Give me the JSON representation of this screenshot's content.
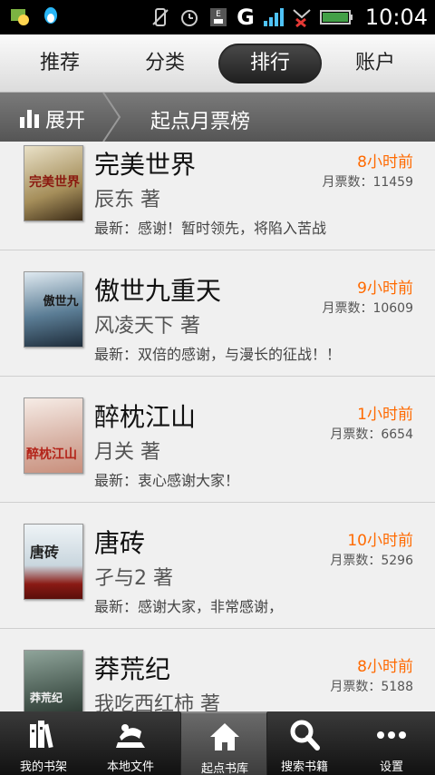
{
  "status_bar": {
    "time": "10:04",
    "network": "G",
    "icons": [
      "photo-icon",
      "qq-icon",
      "silent-icon",
      "alarm-icon",
      "usb-icon",
      "signal-icon",
      "no-signal-icon",
      "battery-icon"
    ]
  },
  "tabs": [
    {
      "label": "推荐",
      "active": false
    },
    {
      "label": "分类",
      "active": false
    },
    {
      "label": "排行",
      "active": true
    },
    {
      "label": "账户",
      "active": false
    }
  ],
  "title_bar": {
    "expand_label": "展开",
    "title": "起点月票榜"
  },
  "books": [
    {
      "title": "完美世界",
      "author": "辰东 著",
      "latest": "最新：感谢！暂时领先，将陷入苦战",
      "time": "8小时前",
      "votes": "月票数：11459"
    },
    {
      "title": "傲世九重天",
      "author": "风凌天下 著",
      "latest": "最新：双倍的感谢，与漫长的征战！！",
      "time": "9小时前",
      "votes": "月票数：10609"
    },
    {
      "title": "醉枕江山",
      "author": "月关 著",
      "latest": "最新：衷心感谢大家！",
      "time": "1小时前",
      "votes": "月票数：6654"
    },
    {
      "title": "唐砖",
      "author": "孑与2 著",
      "latest": "最新：感谢大家，非常感谢，",
      "time": "10小时前",
      "votes": "月票数：5296"
    },
    {
      "title": "莽荒纪",
      "author": "我吃西红柿 著",
      "latest": "",
      "time": "8小时前",
      "votes": "月票数：5188"
    }
  ],
  "bottom_nav": [
    {
      "label": "我的书架",
      "icon": "bookshelf-icon",
      "active": false
    },
    {
      "label": "本地文件",
      "icon": "local-files-icon",
      "active": false
    },
    {
      "label": "起点书库",
      "icon": "home-icon",
      "active": true
    },
    {
      "label": "搜索书籍",
      "icon": "search-icon",
      "active": false
    },
    {
      "label": "设置",
      "icon": "more-icon",
      "active": false
    }
  ],
  "colors": {
    "accent_orange": "#ff6a00",
    "tab_active": "#2a2a2a",
    "titlebar": "#666666"
  }
}
